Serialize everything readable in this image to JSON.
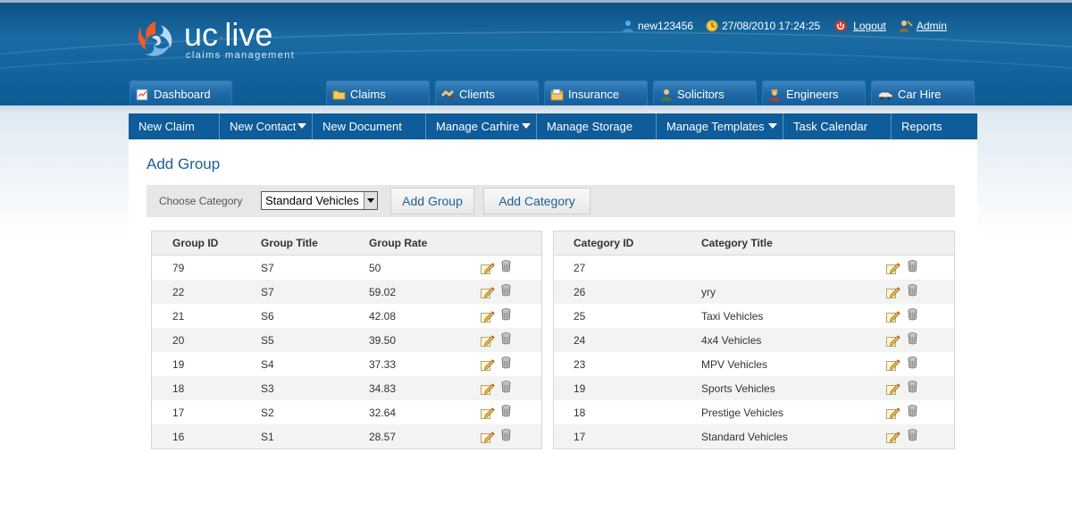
{
  "brand": {
    "name_left": "uc",
    "name_dot": "·",
    "name_right": "live",
    "tagline": "claims management"
  },
  "userbar": {
    "username": "new123456",
    "datetime": "27/08/2010 17:24:25",
    "logout": "Logout",
    "admin": "Admin"
  },
  "tabs": [
    {
      "label": "Dashboard",
      "icon": "clipboard-icon"
    },
    {
      "label": "Claims",
      "icon": "folder-icon"
    },
    {
      "label": "Clients",
      "icon": "handshake-icon"
    },
    {
      "label": "Insurance",
      "icon": "document-icon"
    },
    {
      "label": "Solicitors",
      "icon": "person-icon"
    },
    {
      "label": "Engineers",
      "icon": "engineer-icon"
    },
    {
      "label": "Car Hire",
      "icon": "car-icon"
    }
  ],
  "subnav": [
    {
      "label": "New Claim",
      "dropdown": false
    },
    {
      "label": "New Contact",
      "dropdown": true
    },
    {
      "label": "New Document",
      "dropdown": false
    },
    {
      "label": "Manage Carhire",
      "dropdown": true
    },
    {
      "label": "Manage Storage",
      "dropdown": false
    },
    {
      "label": "Manage Templates",
      "dropdown": true
    },
    {
      "label": "Task Calendar",
      "dropdown": false
    },
    {
      "label": "Reports",
      "dropdown": false
    }
  ],
  "page": {
    "title": "Add Group",
    "choose_category_label": "Choose Category",
    "category_select_value": "Standard Vehicles",
    "add_group_button": "Add Group",
    "add_category_button": "Add Category"
  },
  "groups_table": {
    "headers": [
      "Group ID",
      "Group Title",
      "Group Rate"
    ],
    "rows": [
      {
        "id": "79",
        "title": "S7",
        "rate": "50"
      },
      {
        "id": "22",
        "title": "S7",
        "rate": "59.02"
      },
      {
        "id": "21",
        "title": "S6",
        "rate": "42.08"
      },
      {
        "id": "20",
        "title": "S5",
        "rate": "39.50"
      },
      {
        "id": "19",
        "title": "S4",
        "rate": "37.33"
      },
      {
        "id": "18",
        "title": "S3",
        "rate": "34.83"
      },
      {
        "id": "17",
        "title": "S2",
        "rate": "32.64"
      },
      {
        "id": "16",
        "title": "S1",
        "rate": "28.57"
      }
    ]
  },
  "categories_table": {
    "headers": [
      "Category ID",
      "Category Title"
    ],
    "rows": [
      {
        "id": "27",
        "title": ""
      },
      {
        "id": "26",
        "title": "yry"
      },
      {
        "id": "25",
        "title": "Taxi Vehicles"
      },
      {
        "id": "24",
        "title": "4x4 Vehicles"
      },
      {
        "id": "23",
        "title": "MPV Vehicles"
      },
      {
        "id": "19",
        "title": "Sports Vehicles"
      },
      {
        "id": "18",
        "title": "Prestige Vehicles"
      },
      {
        "id": "17",
        "title": "Standard Vehicles"
      }
    ]
  },
  "colors": {
    "header_blue": "#12629d",
    "subnav_blue": "#0e5c99",
    "title_blue": "#1b5f95",
    "logo_orange": "#f05a28"
  }
}
